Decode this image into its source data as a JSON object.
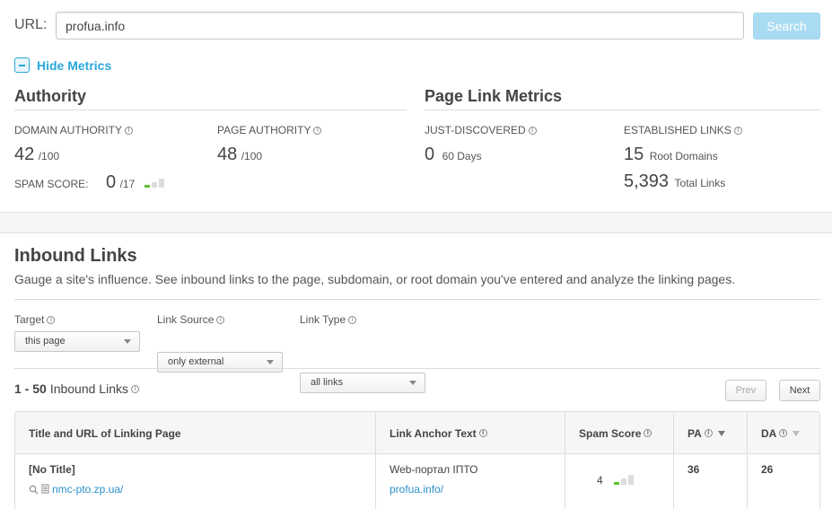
{
  "url_bar": {
    "label": "URL:",
    "value": "profua.info",
    "search_label": "Search"
  },
  "toggle": {
    "label": "Hide Metrics"
  },
  "authority": {
    "title": "Authority",
    "domain_authority": {
      "label": "DOMAIN AUTHORITY",
      "value": "42",
      "max": "/100"
    },
    "page_authority": {
      "label": "PAGE AUTHORITY",
      "value": "48",
      "max": "/100"
    },
    "spam_score": {
      "label": "SPAM SCORE:",
      "value": "0",
      "max": "/17",
      "level": 1,
      "levels_shown": 3
    }
  },
  "page_link_metrics": {
    "title": "Page Link Metrics",
    "just_discovered": {
      "label": "JUST-DISCOVERED",
      "value": "0",
      "unit": "60 Days"
    },
    "established_links": {
      "label": "ESTABLISHED LINKS",
      "root_domains": {
        "value": "15",
        "unit": "Root Domains"
      },
      "total_links": {
        "value": "5,393",
        "unit": "Total Links"
      }
    }
  },
  "inbound": {
    "title": "Inbound Links",
    "description": "Gauge a site's influence. See inbound links to the page, subdomain, or root domain you've entered and analyze the linking pages.",
    "filters": [
      {
        "label": "Target",
        "selected": "this page"
      },
      {
        "label": "Link Source",
        "selected": "only external"
      },
      {
        "label": "Link Type",
        "selected": "all links"
      }
    ],
    "range": "1 - 50",
    "range_suffix": "Inbound Links",
    "prev_label": "Prev",
    "next_label": "Next",
    "columns": [
      "Title and URL of Linking Page",
      "Link Anchor Text",
      "Spam Score",
      "PA",
      "DA"
    ],
    "rows": [
      {
        "title": "[No Title]",
        "url": "nmc-pto.zp.ua/",
        "anchor_text": "Web-портал ІПТО",
        "anchor_url": "profua.info/",
        "spam_score": "4",
        "spam_level": 1,
        "pa": "36",
        "da": "26"
      }
    ]
  },
  "colors": {
    "accent": "#2aa7dc",
    "link": "#2a8fc9",
    "spam_good": "#5bc236",
    "search_button": "#a9dcf3"
  }
}
